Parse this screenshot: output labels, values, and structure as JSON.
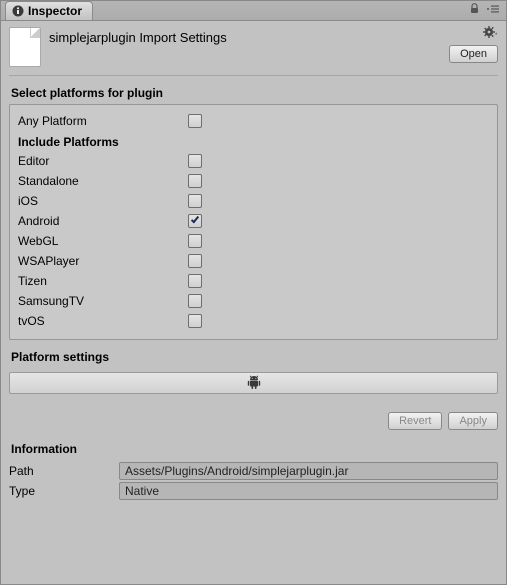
{
  "tab": {
    "title": "Inspector"
  },
  "header": {
    "title": "simplejarplugin Import Settings",
    "open_label": "Open"
  },
  "platforms": {
    "title": "Select platforms for plugin",
    "any_label": "Any Platform",
    "any_checked": false,
    "include_label": "Include Platforms",
    "items": [
      {
        "label": "Editor",
        "checked": false
      },
      {
        "label": "Standalone",
        "checked": false
      },
      {
        "label": "iOS",
        "checked": false
      },
      {
        "label": "Android",
        "checked": true
      },
      {
        "label": "WebGL",
        "checked": false
      },
      {
        "label": "WSAPlayer",
        "checked": false
      },
      {
        "label": "Tizen",
        "checked": false
      },
      {
        "label": "SamsungTV",
        "checked": false
      },
      {
        "label": "tvOS",
        "checked": false
      }
    ]
  },
  "platform_settings": {
    "title": "Platform settings",
    "active_tab": "android"
  },
  "footer": {
    "revert_label": "Revert",
    "apply_label": "Apply"
  },
  "information": {
    "title": "Information",
    "fields": [
      {
        "label": "Path",
        "value": "Assets/Plugins/Android/simplejarplugin.jar"
      },
      {
        "label": "Type",
        "value": "Native"
      }
    ]
  }
}
